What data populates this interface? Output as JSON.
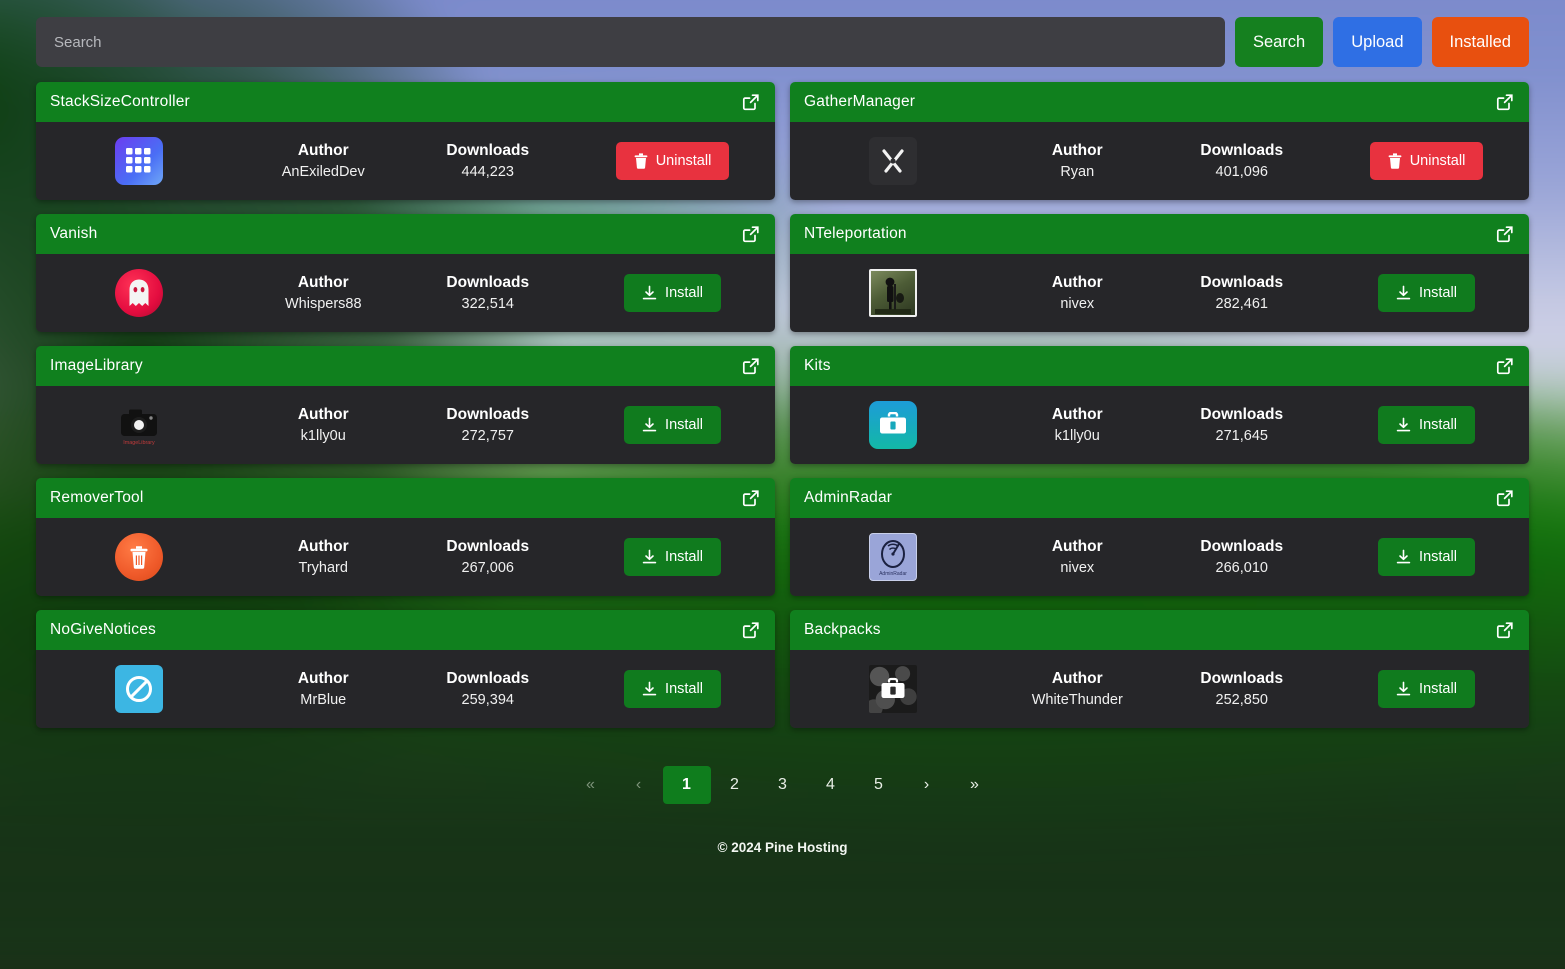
{
  "search": {
    "placeholder": "Search",
    "value": ""
  },
  "toolbar": {
    "search_label": "Search",
    "upload_label": "Upload",
    "installed_label": "Installed",
    "search_color": "#15801f",
    "upload_color": "#2f6fe4",
    "installed_color": "#e8500f"
  },
  "labels": {
    "author": "Author",
    "downloads": "Downloads",
    "install": "Install",
    "uninstall": "Uninstall"
  },
  "plugins": [
    {
      "name": "StackSizeController",
      "author": "AnExiledDev",
      "downloads": "444,223",
      "action": "Uninstall",
      "action_type": "uninstall",
      "icon": "grid-app-icon"
    },
    {
      "name": "GatherManager",
      "author": "Ryan",
      "downloads": "401,096",
      "action": "Uninstall",
      "action_type": "uninstall",
      "icon": "crossed-tools-icon"
    },
    {
      "name": "Vanish",
      "author": "Whispers88",
      "downloads": "322,514",
      "action": "Install",
      "action_type": "install",
      "icon": "ghost-icon"
    },
    {
      "name": "NTeleportation",
      "author": "nivex",
      "downloads": "282,461",
      "action": "Install",
      "action_type": "install",
      "icon": "teleport-figure-icon"
    },
    {
      "name": "ImageLibrary",
      "author": "k1lly0u",
      "downloads": "272,757",
      "action": "Install",
      "action_type": "install",
      "icon": "camera-icon"
    },
    {
      "name": "Kits",
      "author": "k1lly0u",
      "downloads": "271,645",
      "action": "Install",
      "action_type": "install",
      "icon": "toolbox-icon"
    },
    {
      "name": "RemoverTool",
      "author": "Tryhard",
      "downloads": "267,006",
      "action": "Install",
      "action_type": "install",
      "icon": "trash-circle-icon"
    },
    {
      "name": "AdminRadar",
      "author": "nivex",
      "downloads": "266,010",
      "action": "Install",
      "action_type": "install",
      "icon": "radar-icon"
    },
    {
      "name": "NoGiveNotices",
      "author": "MrBlue",
      "downloads": "259,394",
      "action": "Install",
      "action_type": "install",
      "icon": "no-entry-icon"
    },
    {
      "name": "Backpacks",
      "author": "WhiteThunder",
      "downloads": "252,850",
      "action": "Install",
      "action_type": "install",
      "icon": "backpack-icon"
    }
  ],
  "pagination": {
    "items": [
      {
        "label": "«",
        "state": "dim"
      },
      {
        "label": "‹",
        "state": "dim"
      },
      {
        "label": "1",
        "state": "active"
      },
      {
        "label": "2",
        "state": "normal"
      },
      {
        "label": "3",
        "state": "normal"
      },
      {
        "label": "4",
        "state": "normal"
      },
      {
        "label": "5",
        "state": "normal"
      },
      {
        "label": "›",
        "state": "normal"
      },
      {
        "label": "»",
        "state": "normal"
      }
    ],
    "current_page": "1"
  },
  "footer": {
    "copyright": "© 2024 Pine Hosting"
  },
  "colors": {
    "card_header_green": "#10801e",
    "card_body_dark": "#262629",
    "install_green": "#107b1e",
    "uninstall_red": "#e8323f"
  }
}
